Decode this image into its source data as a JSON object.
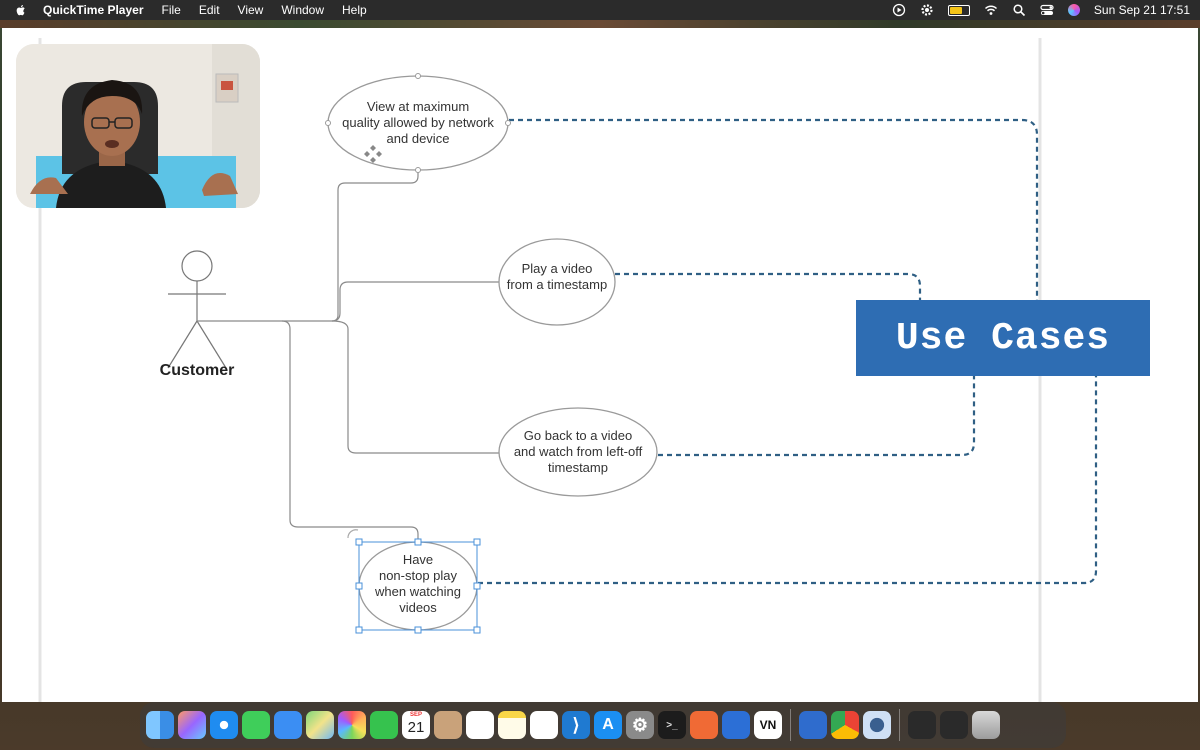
{
  "menubar": {
    "app_name": "QuickTime Player",
    "menus": [
      "File",
      "Edit",
      "View",
      "Window",
      "Help"
    ],
    "datetime": "Sun Sep 21  17:51"
  },
  "diagram": {
    "actor_label": "Customer",
    "use_cases": [
      {
        "lines": [
          "View at maximum",
          "quality allowed by network",
          "and device"
        ]
      },
      {
        "lines": [
          "Play a video",
          "from a timestamp"
        ]
      },
      {
        "lines": [
          "Go back to a video",
          "and watch from left-off",
          "timestamp"
        ]
      },
      {
        "lines": [
          "Have",
          "non-stop play",
          "when watching",
          "videos"
        ]
      }
    ],
    "banner_title": "Use Cases",
    "colors": {
      "banner": "#2e6db3",
      "dashed_line": "#2f5f84",
      "ellipse_stroke": "#9a9a9a",
      "selection": "#4a90d9"
    }
  },
  "dock": {
    "apps": [
      {
        "icon": "finder-icon"
      },
      {
        "icon": "launchpad-icon"
      },
      {
        "icon": "safari-icon"
      },
      {
        "icon": "messages-icon"
      },
      {
        "icon": "mail-icon"
      },
      {
        "icon": "maps-icon"
      },
      {
        "icon": "photos-icon"
      },
      {
        "icon": "facetime-icon"
      },
      {
        "icon": "calendar-icon",
        "month": "SEP",
        "day": "21"
      },
      {
        "icon": "contacts-icon"
      },
      {
        "icon": "reminders-icon"
      },
      {
        "icon": "notes-icon"
      },
      {
        "icon": "freeform-icon"
      },
      {
        "icon": "vscode-icon"
      },
      {
        "icon": "app-store-icon"
      },
      {
        "icon": "system-settings-icon"
      },
      {
        "icon": "terminal-icon"
      },
      {
        "icon": "pen-tool-icon"
      },
      {
        "icon": "xcode-icon"
      },
      {
        "icon": "vn-editor-icon",
        "label": "VN"
      },
      {
        "icon": "xcode-beta-icon"
      },
      {
        "icon": "chrome-icon"
      },
      {
        "icon": "quicktime-icon"
      },
      {
        "icon": "recent-window-icon"
      },
      {
        "icon": "recent-window-icon"
      },
      {
        "icon": "trash-icon"
      }
    ]
  }
}
